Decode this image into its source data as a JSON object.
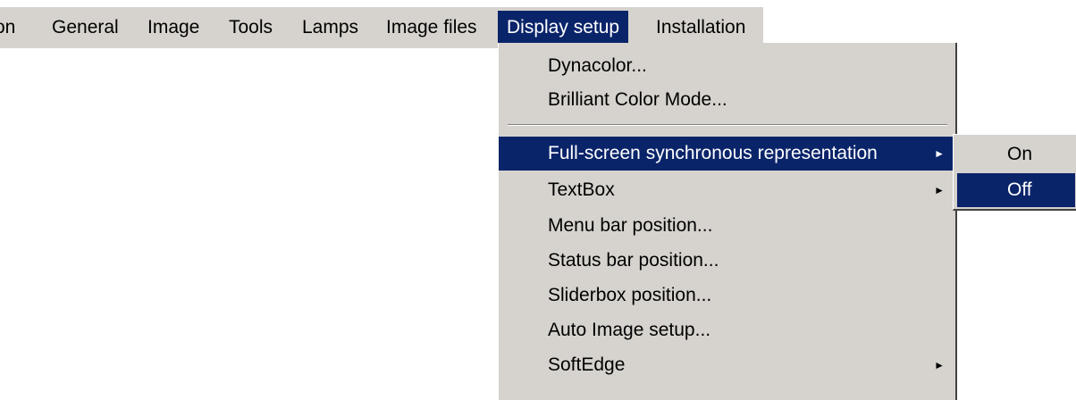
{
  "colors": {
    "menu_background": "#d6d3ce",
    "highlight": "#0a246a",
    "highlight_text": "#ffffff"
  },
  "menubar": {
    "items": [
      {
        "label": "on"
      },
      {
        "label": "General"
      },
      {
        "label": "Image"
      },
      {
        "label": "Tools"
      },
      {
        "label": "Lamps"
      },
      {
        "label": "Image files"
      },
      {
        "label": "Display setup"
      },
      {
        "label": "Installation"
      }
    ]
  },
  "dropdown": {
    "items": [
      {
        "label": "Dynacolor..."
      },
      {
        "label": "Brilliant Color Mode..."
      },
      {
        "label": "Full-screen synchronous representation",
        "arrow": "►"
      },
      {
        "label": "TextBox",
        "arrow": "►"
      },
      {
        "label": "Menu bar position..."
      },
      {
        "label": "Status bar position..."
      },
      {
        "label": "Sliderbox position..."
      },
      {
        "label": "Auto Image setup..."
      },
      {
        "label": "SoftEdge",
        "arrow": "►"
      }
    ]
  },
  "submenu": {
    "items": [
      {
        "label": "On"
      },
      {
        "label": "Off"
      }
    ]
  }
}
